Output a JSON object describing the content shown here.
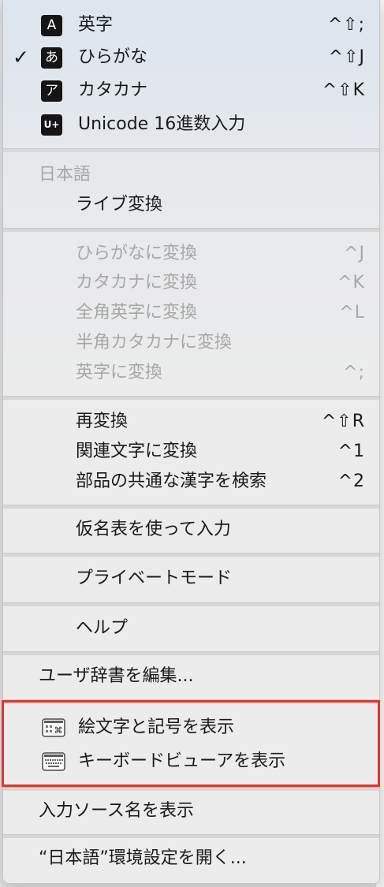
{
  "input_menu": {
    "modes": [
      {
        "icon_char": "A",
        "label": "英字",
        "shortcut": "^⇧;",
        "checked": false
      },
      {
        "icon_char": "あ",
        "label": "ひらがな",
        "shortcut": "^⇧J",
        "checked": true
      },
      {
        "icon_char": "ア",
        "label": "カタカナ",
        "shortcut": "^⇧K",
        "checked": false
      },
      {
        "icon_char": "U+",
        "label": "Unicode 16進数入力",
        "shortcut": "",
        "checked": false
      }
    ],
    "check_mark": "✓",
    "japanese_section": {
      "header": "日本語",
      "live_conversion": "ライブ変換"
    },
    "conversions": [
      {
        "label": "ひらがなに変換",
        "shortcut": "^J"
      },
      {
        "label": "カタカナに変換",
        "shortcut": "^K"
      },
      {
        "label": "全角英字に変換",
        "shortcut": "^L"
      },
      {
        "label": "半角カタカナに変換",
        "shortcut": ""
      },
      {
        "label": "英字に変換",
        "shortcut": "^;"
      }
    ],
    "reconvert_group": [
      {
        "label": "再変換",
        "shortcut": "^⇧R"
      },
      {
        "label": "関連文字に変換",
        "shortcut": "^1"
      },
      {
        "label": "部品の共通な漢字を検索",
        "shortcut": "^2"
      }
    ],
    "kana_table": "仮名表を使って入力",
    "private_mode": "プライベートモード",
    "help": "ヘルプ",
    "edit_dictionary": "ユーザ辞書を編集...",
    "emoji_viewer": "絵文字と記号を表示",
    "keyboard_viewer": "キーボードビューアを表示",
    "show_source_name": "入力ソース名を表示",
    "open_preferences": "“日本語”環境設定を開く..."
  },
  "icons": {
    "emoji_viewer_icon": "command-grid-icon",
    "keyboard_viewer_icon": "keyboard-icon"
  },
  "colors": {
    "highlight_border": "#e8322a",
    "disabled_text": "#a7a7a7"
  }
}
